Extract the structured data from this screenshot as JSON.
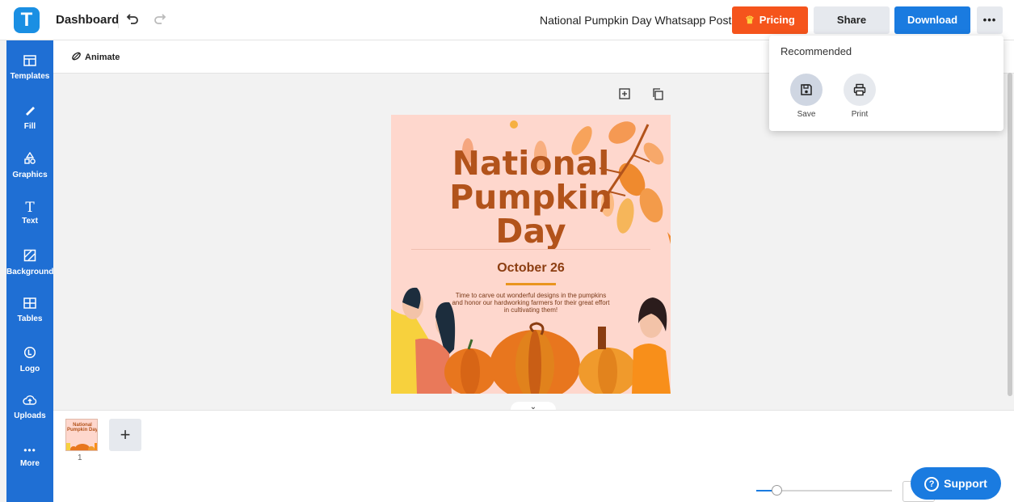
{
  "app": {
    "logo_letter": "T",
    "dashboard_label": "Dashboard",
    "document_title": "National Pumpkin Day Whatsapp Post"
  },
  "header": {
    "pricing_label": "Pricing",
    "share_label": "Share",
    "download_label": "Download",
    "more_label": "•••"
  },
  "sidebar": {
    "items": [
      {
        "label": "Templates",
        "icon": "templates-icon"
      },
      {
        "label": "Fill",
        "icon": "fill-icon"
      },
      {
        "label": "Graphics",
        "icon": "graphics-icon"
      },
      {
        "label": "Text",
        "icon": "text-icon"
      },
      {
        "label": "Background",
        "icon": "background-icon"
      },
      {
        "label": "Tables",
        "icon": "tables-icon"
      },
      {
        "label": "Logo",
        "icon": "logo-icon"
      },
      {
        "label": "Uploads",
        "icon": "uploads-icon"
      },
      {
        "label": "More",
        "icon": "more-icon"
      }
    ]
  },
  "toolbar": {
    "animate_label": "Animate"
  },
  "card": {
    "title_line1": "National",
    "title_line2": "Pumpkin",
    "title_line3": "Day",
    "date": "October 26",
    "body": "Time to carve out wonderful designs in the pumpkins and honor our hardworking farmers for their great effort in cultivating them!"
  },
  "pages": {
    "thumb_text": "National Pumpkin Day",
    "page_number": "1",
    "add_label": "+"
  },
  "zoom": {
    "level_fraction": 0.15
  },
  "support": {
    "label": "Support",
    "icon_glyph": "?"
  },
  "dropdown": {
    "title": "Recommended",
    "items": [
      {
        "label": "Save",
        "icon": "save-icon",
        "active": true
      },
      {
        "label": "Print",
        "icon": "print-icon",
        "active": false
      }
    ]
  },
  "colors": {
    "brand_blue": "#1a7be0",
    "sidebar_blue": "#1f6fd4",
    "pricing_orange": "#f5541c",
    "card_bg": "#fed7cd",
    "title_brown": "#b2531b",
    "pumpkin_orange": "#e8761e"
  }
}
